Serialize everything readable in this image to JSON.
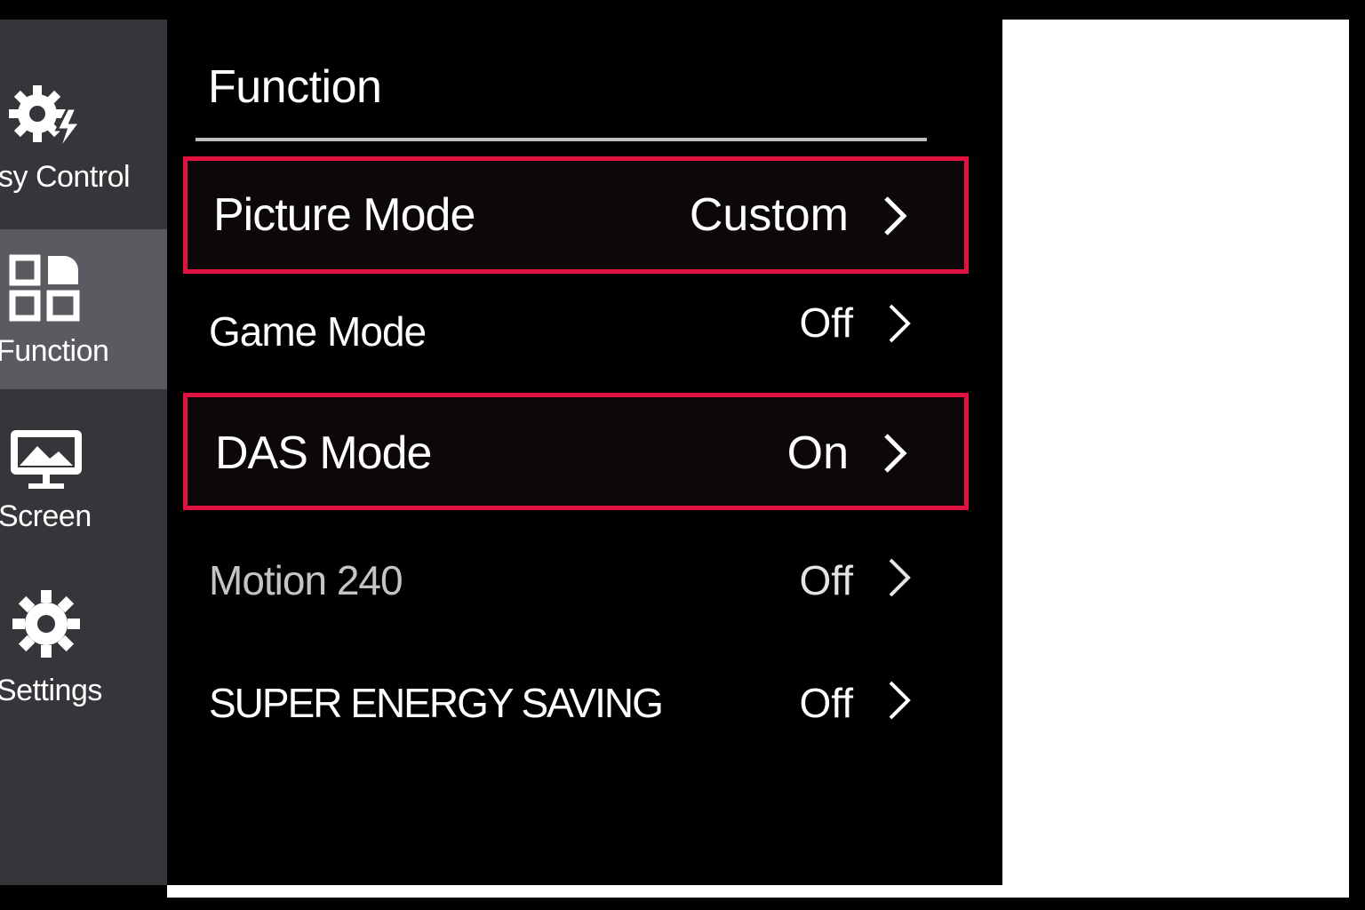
{
  "sidebar": {
    "items": [
      {
        "label": "sy Control",
        "icon": "gear-lightning-icon",
        "active": false
      },
      {
        "label": "Function",
        "icon": "function-grid-icon",
        "active": true
      },
      {
        "label": "Screen",
        "icon": "screen-monitor-icon",
        "active": false
      },
      {
        "label": "Settings",
        "icon": "gear-icon",
        "active": false
      }
    ]
  },
  "main": {
    "title": "Function",
    "rows": [
      {
        "label": "Picture Mode",
        "value": "Custom",
        "highlighted": true
      },
      {
        "label": "Game Mode",
        "value": "Off",
        "highlighted": false
      },
      {
        "label": "DAS Mode",
        "value": "On",
        "highlighted": true
      },
      {
        "label": "Motion 240",
        "value": "Off",
        "highlighted": false,
        "dimmed": true
      },
      {
        "label": "SUPER ENERGY SAVING",
        "value": "Off",
        "highlighted": false
      }
    ]
  },
  "colors": {
    "highlight_border": "#e0123f",
    "sidebar_bg": "#35353a",
    "sidebar_active_bg": "#5a5a60",
    "panel_bg": "#000000"
  }
}
